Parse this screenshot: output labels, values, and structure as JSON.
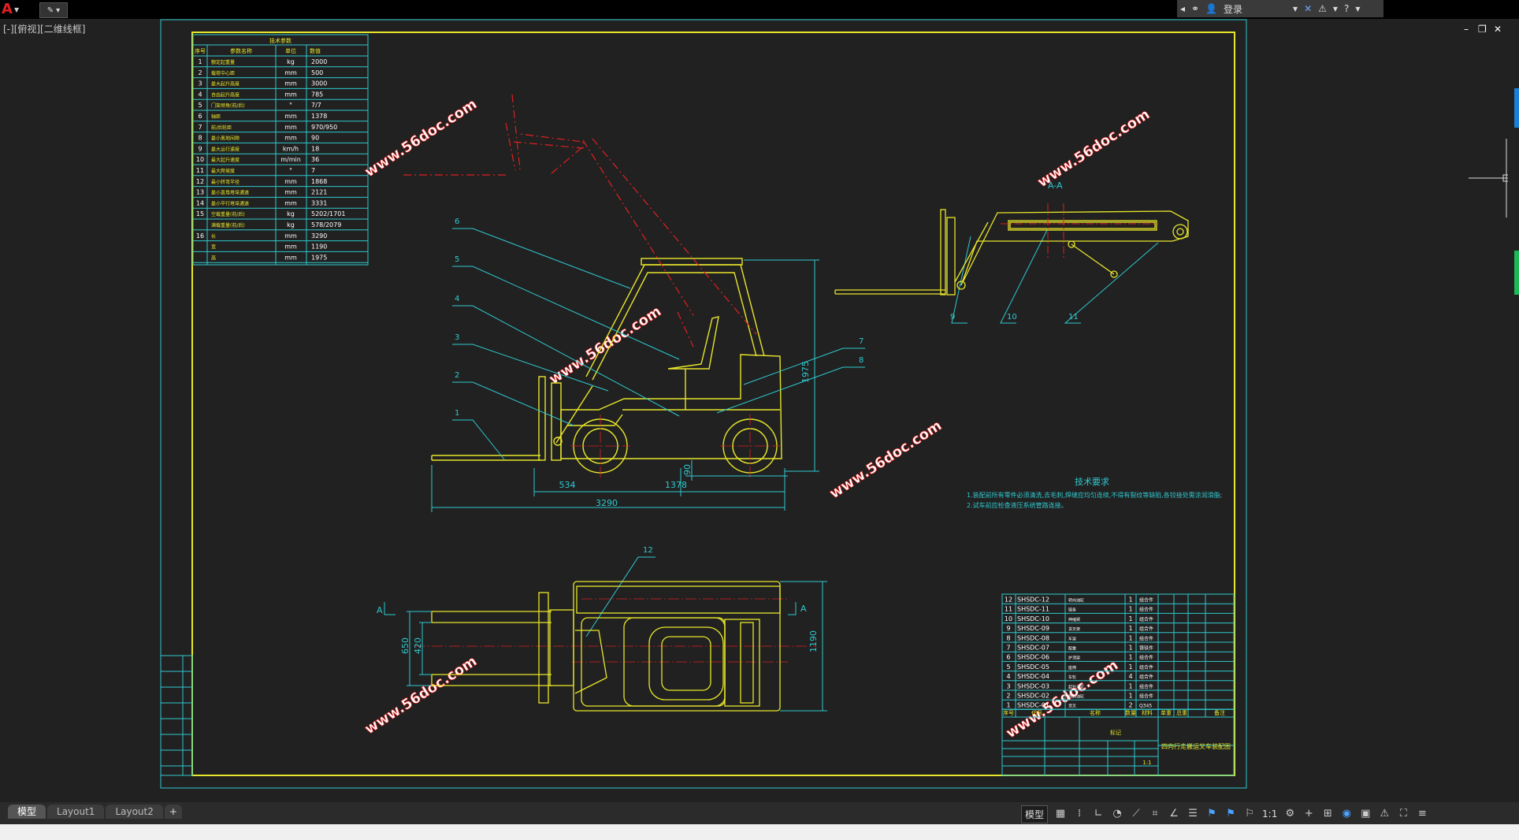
{
  "titlebar": {
    "app_icon": "A",
    "user_login": "登录"
  },
  "view_label": "[-][俯视][二维线框]",
  "tabs": [
    "模型",
    "Layout1",
    "Layout2",
    "+"
  ],
  "status": {
    "model_label": "模型",
    "scale_label": "1:1"
  },
  "params": {
    "title": "技术参数",
    "headers": [
      "序号",
      "参数名称",
      "单位",
      "数值"
    ],
    "rows": [
      {
        "no": "1",
        "name": "额定起重量",
        "unit": "kg",
        "val": "2000"
      },
      {
        "no": "2",
        "name": "载荷中心距",
        "unit": "mm",
        "val": "500"
      },
      {
        "no": "3",
        "name": "最大起升高度",
        "unit": "mm",
        "val": "3000"
      },
      {
        "no": "4",
        "name": "自由起升高度",
        "unit": "mm",
        "val": "785"
      },
      {
        "no": "5",
        "name": "门架倾角(前/后)",
        "unit": "°",
        "val": "7/7"
      },
      {
        "no": "6",
        "name": "轴距",
        "unit": "mm",
        "val": "1378"
      },
      {
        "no": "7",
        "name": "前/后轮距",
        "unit": "mm",
        "val": "970/950"
      },
      {
        "no": "8",
        "name": "最小离地间隙",
        "unit": "mm",
        "val": "90"
      },
      {
        "no": "9",
        "name": "最大运行速度",
        "unit": "km/h",
        "val": "18"
      },
      {
        "no": "10",
        "name": "最大起升速度",
        "unit": "m/min",
        "val": "36"
      },
      {
        "no": "11",
        "name": "最大爬坡度",
        "unit": "°",
        "val": "7"
      },
      {
        "no": "12",
        "name": "最小转弯半径",
        "unit": "mm",
        "val": "1868"
      },
      {
        "no": "13",
        "name": "最小直角堆垛通道",
        "unit": "mm",
        "val": "2121"
      },
      {
        "no": "14",
        "name": "最小平行堆垛通道",
        "unit": "mm",
        "val": "3331"
      },
      {
        "no": "15",
        "name": "空载重量(前/后)",
        "unit": "kg",
        "val": "5202/1701"
      },
      {
        "no": "",
        "name": "满载重量(前/后)",
        "unit": "kg",
        "val": "578/2079"
      },
      {
        "no": "16",
        "name": "长",
        "unit": "mm",
        "val": "3290"
      },
      {
        "no": "",
        "name": "宽",
        "unit": "mm",
        "val": "1190"
      },
      {
        "no": "",
        "name": "高",
        "unit": "mm",
        "val": "1975"
      }
    ]
  },
  "dimensions": {
    "d534": "534",
    "d1378": "1378",
    "d3290": "3290",
    "d1975": "1975",
    "d90": "90",
    "d650": "650",
    "d420": "420",
    "d1190": "1190"
  },
  "callouts": [
    "1",
    "2",
    "3",
    "4",
    "5",
    "6",
    "7",
    "8",
    "9",
    "10",
    "11",
    "12"
  ],
  "section": {
    "label": "A-A",
    "a_left": "A",
    "a_right": "A"
  },
  "tech_req": {
    "title": "技术要求",
    "line1": "1.装配前所有零件必须清洗,去毛刺,焊缝应均匀连续,不得有裂纹等缺陷,各铰接处需涂润滑脂;",
    "line2": "2.试车前应检查液压系统管路连接。"
  },
  "watermark": "www.56doc.com",
  "bom": {
    "rows": [
      {
        "no": "12",
        "code": "SHSDC-12",
        "name": "转向油缸",
        "qty": "1",
        "mat": "组合件"
      },
      {
        "no": "11",
        "code": "SHSDC-11",
        "name": "链条",
        "qty": "1",
        "mat": "组合件"
      },
      {
        "no": "10",
        "code": "SHSDC-10",
        "name": "伸缩臂",
        "qty": "1",
        "mat": "组合件"
      },
      {
        "no": "9",
        "code": "SHSDC-09",
        "name": "货叉架",
        "qty": "1",
        "mat": "组合件"
      },
      {
        "no": "8",
        "code": "SHSDC-08",
        "name": "车架",
        "qty": "1",
        "mat": "组合件"
      },
      {
        "no": "7",
        "code": "SHSDC-07",
        "name": "配重",
        "qty": "1",
        "mat": "铸铁件"
      },
      {
        "no": "6",
        "code": "SHSDC-06",
        "name": "护顶架",
        "qty": "1",
        "mat": "组合件"
      },
      {
        "no": "5",
        "code": "SHSDC-05",
        "name": "座椅",
        "qty": "1",
        "mat": "组合件"
      },
      {
        "no": "4",
        "code": "SHSDC-04",
        "name": "车轮",
        "qty": "4",
        "mat": "组合件"
      },
      {
        "no": "3",
        "code": "SHSDC-03",
        "name": "起升油缸",
        "qty": "1",
        "mat": "组合件"
      },
      {
        "no": "2",
        "code": "SHSDC-02",
        "name": "倾斜油缸",
        "qty": "1",
        "mat": "组合件"
      },
      {
        "no": "1",
        "code": "SHSDC-01",
        "name": "货叉",
        "qty": "2",
        "mat": "Q345"
      }
    ],
    "header": [
      "序号",
      "代号",
      "名称",
      "数量",
      "材料",
      "单重",
      "总重",
      "备注"
    ],
    "title_name": "四向行走搬运叉车装配图",
    "scale": "1:1",
    "title_mark": "标记"
  }
}
